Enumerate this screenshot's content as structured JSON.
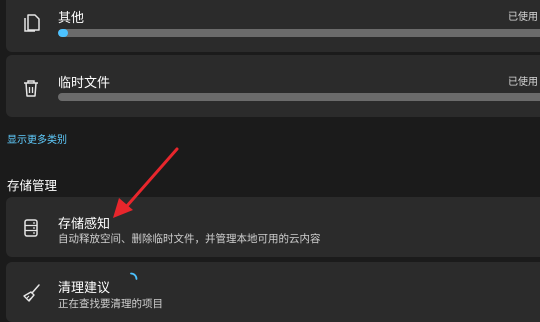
{
  "storage_categories": [
    {
      "name": "其他",
      "status": "已使用",
      "usage_fraction": 0.02,
      "icon": "document-icon"
    },
    {
      "name": "临时文件",
      "status": "已使用",
      "usage_fraction": 0.0,
      "icon": "trash-icon"
    }
  ],
  "show_more_link": "显示更多类别",
  "storage_management": {
    "heading": "存储管理",
    "storage_sense": {
      "title": "存储感知",
      "description": "自动释放空间、删除临时文件，并管理本地可用的云内容",
      "icon": "storage-drive-icon"
    },
    "cleanup": {
      "title": "清理建议",
      "description": "正在查找要清理的项目",
      "icon": "broom-icon"
    }
  },
  "colors": {
    "background": "#1b1b1b",
    "card": "#2b2b2b",
    "accent": "#4cc2ff",
    "link": "#60cdff",
    "annotation_arrow": "#e8262c"
  }
}
